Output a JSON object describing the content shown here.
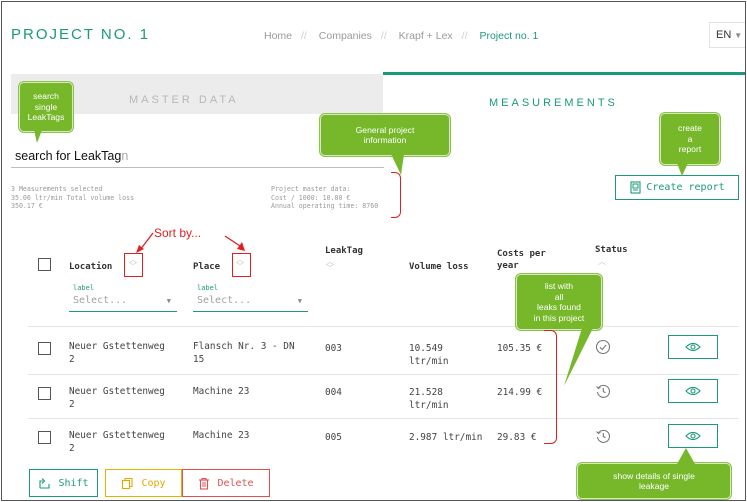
{
  "header": {
    "project_title": "PROJECT NO. 1",
    "breadcrumb": [
      "Home",
      "Companies",
      "Krapf + Lex",
      "Project no. 1"
    ],
    "language": "EN"
  },
  "tabs": [
    {
      "label": "MASTER DATA",
      "active": false
    },
    {
      "label": "MEASUREMENTS",
      "active": true
    }
  ],
  "search": {
    "placeholder": "Search for LeakTag",
    "value": ""
  },
  "summary": {
    "selected": "3 Measurements selected",
    "volume_loss": "35.06 ltr/min Total volume loss",
    "costs": "350.17 €",
    "master_title": "Project master data:",
    "cost_rate": "Cost / 1000: 10.00 €",
    "operating_time": "Annual operating time: 8760"
  },
  "create_report": "Create report",
  "table": {
    "columns": {
      "location": "Location",
      "place": "Place",
      "leaktag": "LeakTag",
      "volume_loss": "Volume loss",
      "costs_line1": "Costs per",
      "costs_line2": "year",
      "status": "Status"
    },
    "filter_label": "label",
    "filter_placeholder": "Select...",
    "rows": [
      {
        "location": [
          "Neuer Gstettenweg",
          "2"
        ],
        "place": [
          "Flansch Nr. 3 - DN",
          "15"
        ],
        "leaktag": "003",
        "volume": [
          "10.549",
          "ltr/min"
        ],
        "costs": "105.35 €",
        "status": "check-circle-icon"
      },
      {
        "location": [
          "Neuer Gstettenweg",
          "2"
        ],
        "place": [
          "Machine 23",
          ""
        ],
        "leaktag": "004",
        "volume": [
          "21.528",
          "ltr/min"
        ],
        "costs": "214.99 €",
        "status": "history-icon"
      },
      {
        "location": [
          "Neuer Gstettenweg",
          "2"
        ],
        "place": [
          "Machine 23",
          ""
        ],
        "leaktag": "005",
        "volume": [
          "2.987 ltr/min",
          ""
        ],
        "costs": "29.83 €",
        "status": "history-icon"
      }
    ]
  },
  "actions": {
    "shift": "Shift",
    "copy": "Copy",
    "delete": "Delete"
  },
  "annotations": {
    "search_single": [
      "search",
      "single",
      "LeakTags"
    ],
    "search_for": "search for LeakTag",
    "general_info": [
      "General project",
      "information"
    ],
    "create_report": [
      "create",
      "a",
      "report"
    ],
    "sort_by": "Sort by...",
    "list_leaks": [
      "list with",
      "all",
      "leaks found",
      "in this project"
    ],
    "show_details": [
      "show details of single",
      "leakage"
    ]
  },
  "colors": {
    "accent": "#1a9a7b",
    "annotation_green": "#76b82a",
    "annotation_red": "#e02020",
    "copy_yellow": "#e6a800",
    "delete_red": "#e05050"
  }
}
